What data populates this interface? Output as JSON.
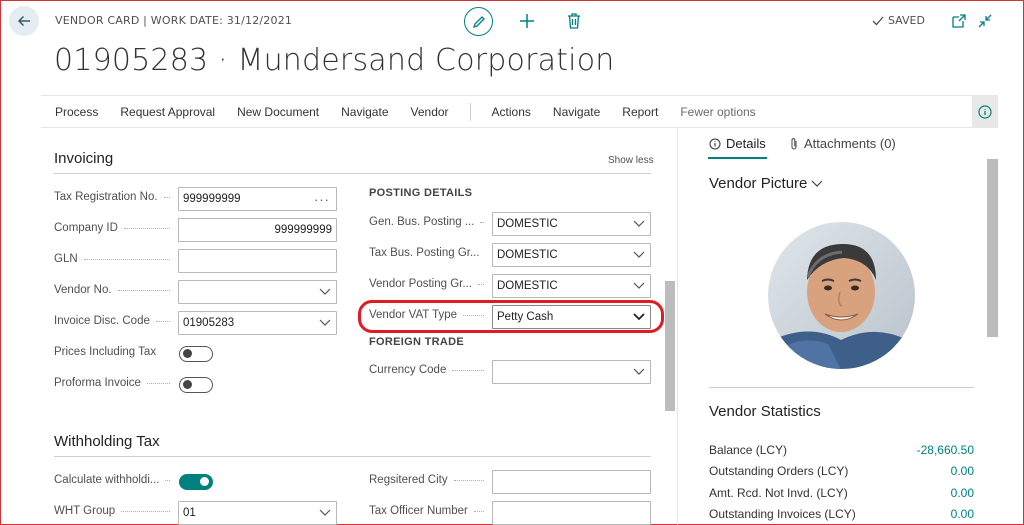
{
  "header": {
    "title": "VENDOR CARD | WORK DATE: 31/12/2021",
    "status": "SAVED",
    "record_title": "01905283 · Mundersand Corporation"
  },
  "action_bar": {
    "items": [
      "Process",
      "Request Approval",
      "New Document",
      "Navigate",
      "Vendor"
    ],
    "items2": [
      "Actions",
      "Navigate",
      "Report"
    ],
    "fewer": "Fewer options"
  },
  "invoicing": {
    "title": "Invoicing",
    "show_less": "Show less",
    "tax_registration_label": "Tax Registration No.",
    "tax_registration_value": "999999999",
    "company_id_label": "Company ID",
    "company_id_value": "999999999",
    "gln_label": "GLN",
    "gln_value": "",
    "vendor_no_label": "Vendor No.",
    "vendor_no_value": "",
    "invoice_disc_label": "Invoice Disc. Code",
    "invoice_disc_value": "01905283",
    "prices_incl_tax_label": "Prices Including Tax",
    "prices_incl_tax": false,
    "proforma_label": "Proforma Invoice",
    "proforma": false,
    "posting_details": "POSTING DETAILS",
    "gen_bus_label": "Gen. Bus. Posting ...",
    "gen_bus_value": "DOMESTIC",
    "tax_bus_label": "Tax Bus. Posting Gr...",
    "tax_bus_value": "DOMESTIC",
    "vendor_posting_label": "Vendor Posting Gr...",
    "vendor_posting_value": "DOMESTIC",
    "vendor_vat_label": "Vendor VAT Type",
    "vendor_vat_value": "Petty Cash",
    "foreign_trade": "FOREIGN TRADE",
    "currency_label": "Currency Code",
    "currency_value": ""
  },
  "withholding": {
    "title": "Withholding Tax",
    "calc_label": "Calculate withholdi...",
    "calc": true,
    "wht_group_label": "WHT Group",
    "wht_group_value": "01",
    "city_label": "Regsitered City",
    "city_value": "",
    "officer_label": "Tax Officer Number",
    "officer_value": ""
  },
  "factbox": {
    "tab_details": "Details",
    "tab_attachments": "Attachments (0)",
    "picture_title": "Vendor Picture",
    "stats_title": "Vendor Statistics",
    "stats": [
      {
        "label": "Balance (LCY)",
        "value": "-28,660.50"
      },
      {
        "label": "Outstanding Orders (LCY)",
        "value": "0.00"
      },
      {
        "label": "Amt. Rcd. Not Invd. (LCY)",
        "value": "0.00"
      },
      {
        "label": "Outstanding Invoices (LCY)",
        "value": "0.00"
      }
    ]
  },
  "colors": {
    "accent": "#00807f",
    "highlight": "#e01b24"
  }
}
